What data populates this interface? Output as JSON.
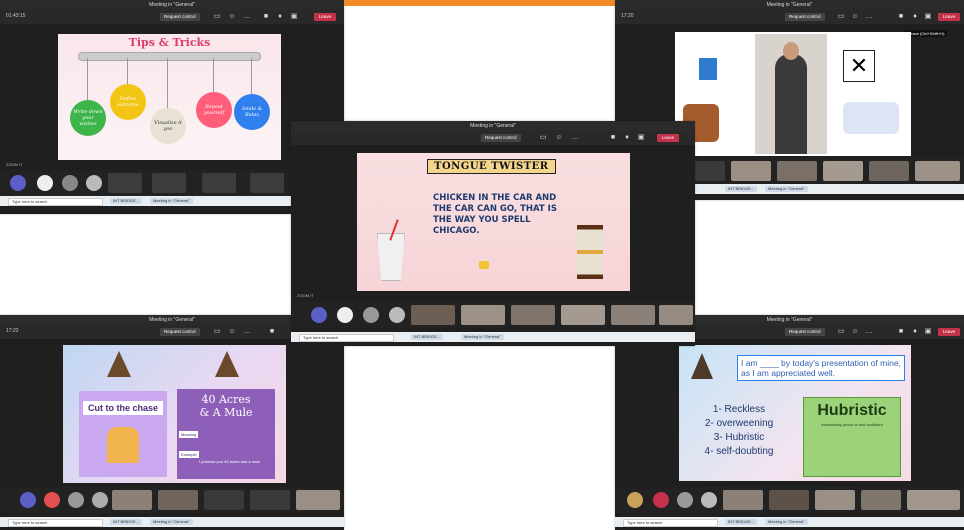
{
  "meeting_title": "Meeting in \"General\"",
  "request_control": "Request control",
  "leave": "Leave",
  "taskbar": {
    "search": "Type here to search",
    "app1": "INT BRIDGE...",
    "app2": "Meeting in \"General\""
  },
  "colors": {
    "leave": "#c4314b",
    "teams_dark": "#1f1f1f",
    "accent": "#6264a7"
  },
  "win_tl": {
    "time": "01:43:15",
    "slide_title": "Tips & Tricks",
    "bubbles": [
      "Write down your wishes",
      "Define outcome",
      "Visualise it yoo",
      "Repeat yourself",
      "Smile & Relax"
    ],
    "bubble_colors": [
      "#3db54a",
      "#f2c413",
      "#e8e2d4",
      "#ff5d7a",
      "#2f80ed"
    ]
  },
  "win_tr": {
    "time": "17:20",
    "tooltip": "Leave (Ctrl+Shift+H)"
  },
  "win_center": {
    "banner": "TONGUE TWISTER",
    "text": "CHICKEN IN THE CAR AND THE CAR CAN GO, THAT IS THE WAY YOU SPELL CHICAGO.",
    "label": "ZOOM IT"
  },
  "win_bl": {
    "time": "17:22",
    "idiom1": "Cut to the chase",
    "idiom2_line1": "40 Acres",
    "idiom2_line2": "& A Mule",
    "tag1": "Meaning",
    "tag2": "Example",
    "example_text": "I promise you 40 acres and a mule"
  },
  "win_br": {
    "prompt": "I am ____ by today's presentation of mine, as I am appreciated well.",
    "options": [
      "1- Reckless",
      "2- overweening",
      "3- Hubristic",
      "4- self-doubting"
    ],
    "answer": "Hubristic",
    "answer_sub": "excessively proud or self-confident"
  }
}
